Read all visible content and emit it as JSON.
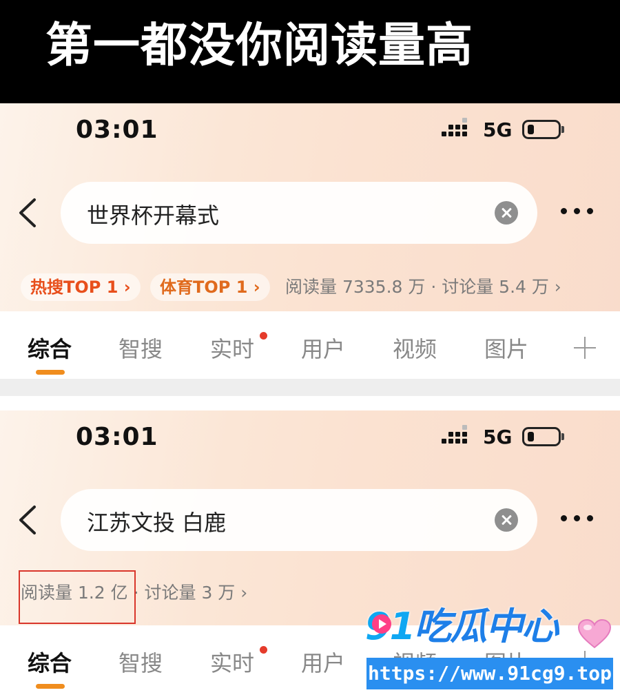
{
  "banner": {
    "title": "第一都没你阅读量高"
  },
  "screens": [
    {
      "status": {
        "time": "03:01",
        "network": "5G"
      },
      "search": {
        "query": "世界杯开幕式"
      },
      "chips": [
        "热搜TOP 1 ›",
        "体育TOP 1 ›"
      ],
      "stats": "阅读量 7335.8 万 · 讨论量 5.4 万 ›",
      "tabs": [
        "综合",
        "智搜",
        "实时",
        "用户",
        "视频",
        "图片"
      ],
      "active_tab": "综合"
    },
    {
      "status": {
        "time": "03:01",
        "network": "5G"
      },
      "search": {
        "query": "江苏文投 白鹿"
      },
      "stats": "阅读量 1.2 亿 · 讨论量 3 万 ›",
      "tabs": [
        "综合",
        "智搜",
        "实时",
        "用户",
        "视频",
        "图片"
      ],
      "active_tab": "综合"
    }
  ],
  "watermark": {
    "logo_digits": "91",
    "logo_text": "吃瓜中心",
    "url": "https://www.91cg9.top"
  },
  "colors": {
    "hot_chip": "#e84f1c",
    "sport_chip": "#e06a1d",
    "tab_underline": "#f08d1e",
    "highlight_box": "#d9352a",
    "watermark_blue": "#2a8ff0"
  },
  "icons": [
    "back-arrow-icon",
    "clear-icon",
    "more-icon",
    "plus-icon",
    "signal-icon",
    "battery-icon"
  ]
}
